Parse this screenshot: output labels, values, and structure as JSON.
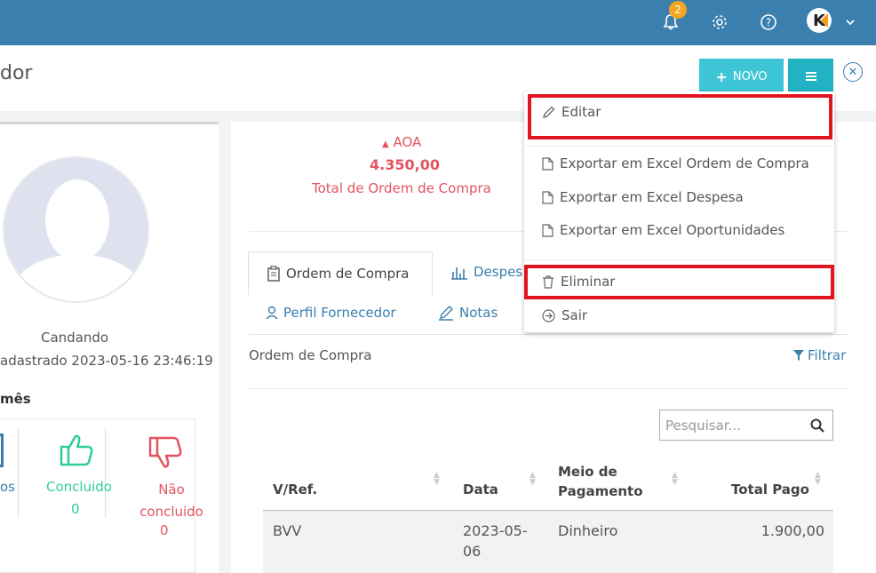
{
  "topbar": {
    "notification_count": "2",
    "icons": [
      "bell-icon",
      "gear-icon",
      "help-icon",
      "user-avatar",
      "chevron-down-icon"
    ]
  },
  "header": {
    "title": "dor",
    "new_button_label": "NOVO"
  },
  "profile": {
    "name": "Candando",
    "registered": "adastrado 2023-05-16 23:46:19",
    "month_title": "mês",
    "stats": [
      {
        "label": "os",
        "value": ""
      },
      {
        "label": "Concluido",
        "value": "0"
      },
      {
        "label": "Não concluido",
        "value": "0"
      }
    ]
  },
  "summary": {
    "currency": "AOA",
    "amount": "4.350,00",
    "label": "Total de Ordem de Compra"
  },
  "tabs": [
    {
      "label": "Ordem de Compra",
      "active": true
    },
    {
      "label": "Despes",
      "active": false
    },
    {
      "label": "Perfil Fornecedor",
      "active": false
    },
    {
      "label": "Notas",
      "active": false
    }
  ],
  "section": {
    "title": "Ordem de Compra",
    "filter_label": "Filtrar",
    "search_placeholder": "Pesquisar..."
  },
  "table": {
    "columns": [
      "V/Ref.",
      "Data",
      "Meio de Pagamento",
      "Total Pago"
    ],
    "rows": [
      {
        "ref": "BVV",
        "date": "2023-05-06",
        "payment": "Dinheiro",
        "total": "1.900,00"
      }
    ]
  },
  "dropdown": {
    "items": [
      {
        "label": "Editar",
        "icon": "pencil-icon"
      },
      {
        "label": "Exportar em Excel Ordem de Compra",
        "icon": "file-icon"
      },
      {
        "label": "Exportar em Excel Despesa",
        "icon": "file-icon"
      },
      {
        "label": "Exportar em Excel Oportunidades",
        "icon": "file-icon"
      },
      {
        "label": "Eliminar",
        "icon": "trash-icon"
      },
      {
        "label": "Sair",
        "icon": "exit-circle-icon"
      }
    ]
  },
  "colors": {
    "topbar": "#3a7fae",
    "accent_cyan": "#3ec6d6",
    "danger_text": "#e2545f",
    "highlight": "#e01520",
    "success": "#2ecc9a"
  }
}
